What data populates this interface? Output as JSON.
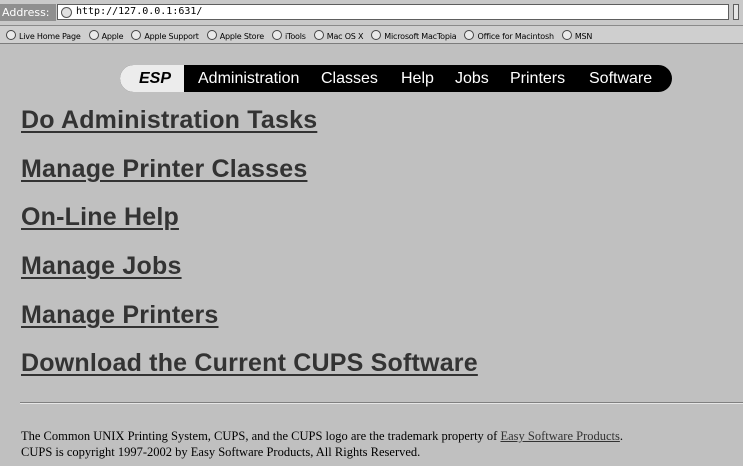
{
  "browser": {
    "address_label": "Address:",
    "url": "http://127.0.0.1:631/",
    "favorites": [
      "Live Home Page",
      "Apple",
      "Apple Support",
      "Apple Store",
      "iTools",
      "Mac OS X",
      "Microsoft MacTopia",
      "Office for Macintosh",
      "MSN"
    ]
  },
  "nav": {
    "brand": "ESP",
    "items": [
      "Administration",
      "Classes",
      "Help",
      "Jobs",
      "Printers",
      "Software"
    ]
  },
  "links": [
    "Do Administration Tasks",
    "Manage Printer Classes",
    "On-Line Help",
    "Manage Jobs",
    "Manage Printers",
    "Download the Current CUPS Software"
  ],
  "footer": {
    "line1_text": "The Common UNIX Printing System, CUPS, and the CUPS logo are the trademark property of ",
    "line1_link": "Easy Software Products",
    "line1_end": ".",
    "line2": "CUPS is copyright 1997-2002 by Easy Software Products, All Rights Reserved."
  },
  "colors": {
    "page_background": "#c0c0c0",
    "nav_background": "#000000",
    "nav_text": "#ffffff",
    "brand_background": "#ececec",
    "link_color": "#333333"
  }
}
